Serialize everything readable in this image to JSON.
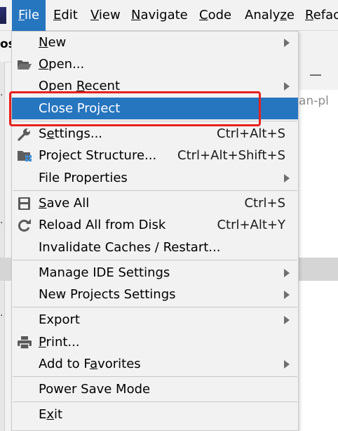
{
  "menubar": {
    "items": [
      {
        "mnemonic": "F",
        "rest": "ile"
      },
      {
        "mnemonic": "E",
        "rest": "dit"
      },
      {
        "mnemonic": "V",
        "rest": "iew"
      },
      {
        "mnemonic": "N",
        "rest": "avigate"
      },
      {
        "mnemonic": "C",
        "rest": "ode"
      },
      {
        "pre": "Analy",
        "mnemonic": "z",
        "rest": "e"
      },
      {
        "mnemonic": "R",
        "rest": "efac"
      }
    ],
    "active": "File"
  },
  "background": {
    "project_label": "os",
    "editor_tab_text": "an-pl"
  },
  "file_menu": {
    "items": [
      {
        "id": "new",
        "pre": "",
        "mnemonic": "N",
        "rest": "ew",
        "shortcut": "",
        "submenu": true,
        "icon": ""
      },
      {
        "id": "open",
        "pre": "",
        "mnemonic": "O",
        "rest": "pen...",
        "shortcut": "",
        "submenu": false,
        "icon": "folder-open-icon"
      },
      {
        "id": "open-recent",
        "pre": "Open ",
        "mnemonic": "R",
        "rest": "ecent",
        "shortcut": "",
        "submenu": true,
        "icon": ""
      },
      {
        "id": "close-project",
        "pre": "Close Project",
        "mnemonic": "",
        "rest": "",
        "shortcut": "",
        "submenu": false,
        "icon": "",
        "selected": true
      },
      {
        "id": "settings",
        "pre": "S",
        "mnemonic": "e",
        "rest": "ttings...",
        "shortcut": "Ctrl+Alt+S",
        "submenu": false,
        "icon": "wrench-icon"
      },
      {
        "id": "project-structure",
        "pre": "Project Structure...",
        "mnemonic": "",
        "rest": "",
        "shortcut": "Ctrl+Alt+Shift+S",
        "submenu": false,
        "icon": "project-structure-icon"
      },
      {
        "id": "file-properties",
        "pre": "File Properties",
        "mnemonic": "",
        "rest": "",
        "shortcut": "",
        "submenu": true,
        "icon": ""
      },
      {
        "id": "save-all",
        "pre": "",
        "mnemonic": "S",
        "rest": "ave All",
        "shortcut": "Ctrl+S",
        "submenu": false,
        "icon": "save-icon"
      },
      {
        "id": "reload-all",
        "pre": "Reload All from Disk",
        "mnemonic": "",
        "rest": "",
        "shortcut": "Ctrl+Alt+Y",
        "submenu": false,
        "icon": "reload-icon"
      },
      {
        "id": "invalidate-caches",
        "pre": "Invalidate Caches / Restart...",
        "mnemonic": "",
        "rest": "",
        "shortcut": "",
        "submenu": false,
        "icon": ""
      },
      {
        "id": "manage-ide-settings",
        "pre": "Manage IDE Settings",
        "mnemonic": "",
        "rest": "",
        "shortcut": "",
        "submenu": true,
        "icon": ""
      },
      {
        "id": "new-projects-settings",
        "pre": "New Projects Settings",
        "mnemonic": "",
        "rest": "",
        "shortcut": "",
        "submenu": true,
        "icon": ""
      },
      {
        "id": "export",
        "pre": "Export",
        "mnemonic": "",
        "rest": "",
        "shortcut": "",
        "submenu": true,
        "icon": ""
      },
      {
        "id": "print",
        "pre": "",
        "mnemonic": "P",
        "rest": "rint...",
        "shortcut": "",
        "submenu": false,
        "icon": "printer-icon"
      },
      {
        "id": "add-to-favorites",
        "pre": "Add to F",
        "mnemonic": "a",
        "rest": "vorites",
        "shortcut": "",
        "submenu": true,
        "icon": ""
      },
      {
        "id": "power-save-mode",
        "pre": "Power Save Mode",
        "mnemonic": "",
        "rest": "",
        "shortcut": "",
        "submenu": false,
        "icon": ""
      },
      {
        "id": "exit",
        "pre": "E",
        "mnemonic": "x",
        "rest": "it",
        "shortcut": "",
        "submenu": false,
        "icon": ""
      }
    ]
  },
  "colors": {
    "selection": "#2675bf",
    "highlight_box": "#e8211c",
    "menu_bg": "#f2f2f2"
  }
}
